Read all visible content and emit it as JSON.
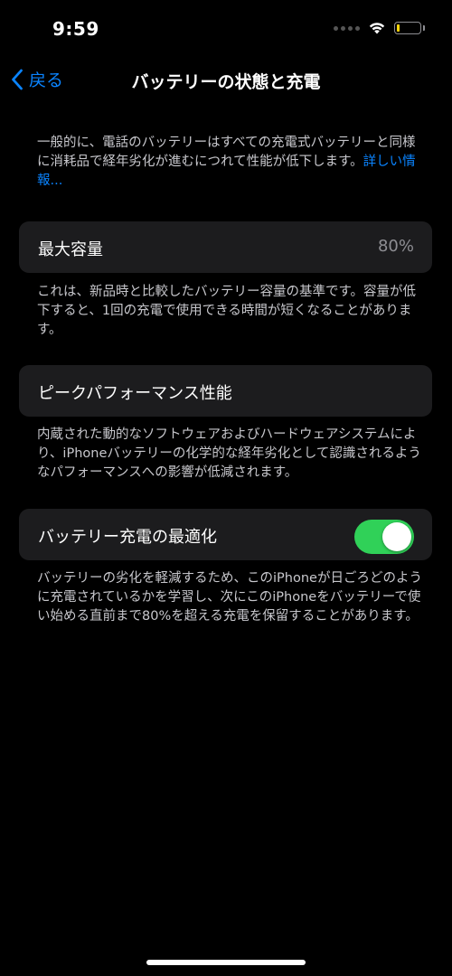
{
  "status_bar": {
    "time": "9:59",
    "battery_level": 0.15,
    "icons": [
      "signal-dots-icon",
      "wifi-icon",
      "battery-icon"
    ]
  },
  "nav": {
    "back_label": "戻る",
    "title": "バッテリーの状態と充電"
  },
  "intro": {
    "text": "一般的に、電話のバッテリーはすべての充電式バッテリーと同様に消耗品で経年劣化が進むにつれて性能が低下します。",
    "link": "詳しい情報..."
  },
  "max_capacity": {
    "label": "最大容量",
    "value": "80%",
    "footer": "これは、新品時と比較したバッテリー容量の基準です。容量が低下すると、1回の充電で使用できる時間が短くなることがあります。"
  },
  "peak_performance": {
    "label": "ピークパフォーマンス性能",
    "footer": "内蔵された動的なソフトウェアおよびハードウェアシステムにより、iPhoneバッテリーの化学的な経年劣化として認識されるようなパフォーマンスへの影響が低減されます。"
  },
  "optimized_charging": {
    "label": "バッテリー充電の最適化",
    "enabled": true,
    "footer": "バッテリーの劣化を軽減するため、このiPhoneが日ごろどのように充電されているかを学習し、次にこのiPhoneをバッテリーで使い始める直前まで80%を超える充電を保留することがあります。"
  },
  "colors": {
    "background": "#000000",
    "cell": "#1c1c1e",
    "accent": "#0a84ff",
    "toggle_on": "#30d158",
    "secondary_text": "#8e8e93"
  }
}
